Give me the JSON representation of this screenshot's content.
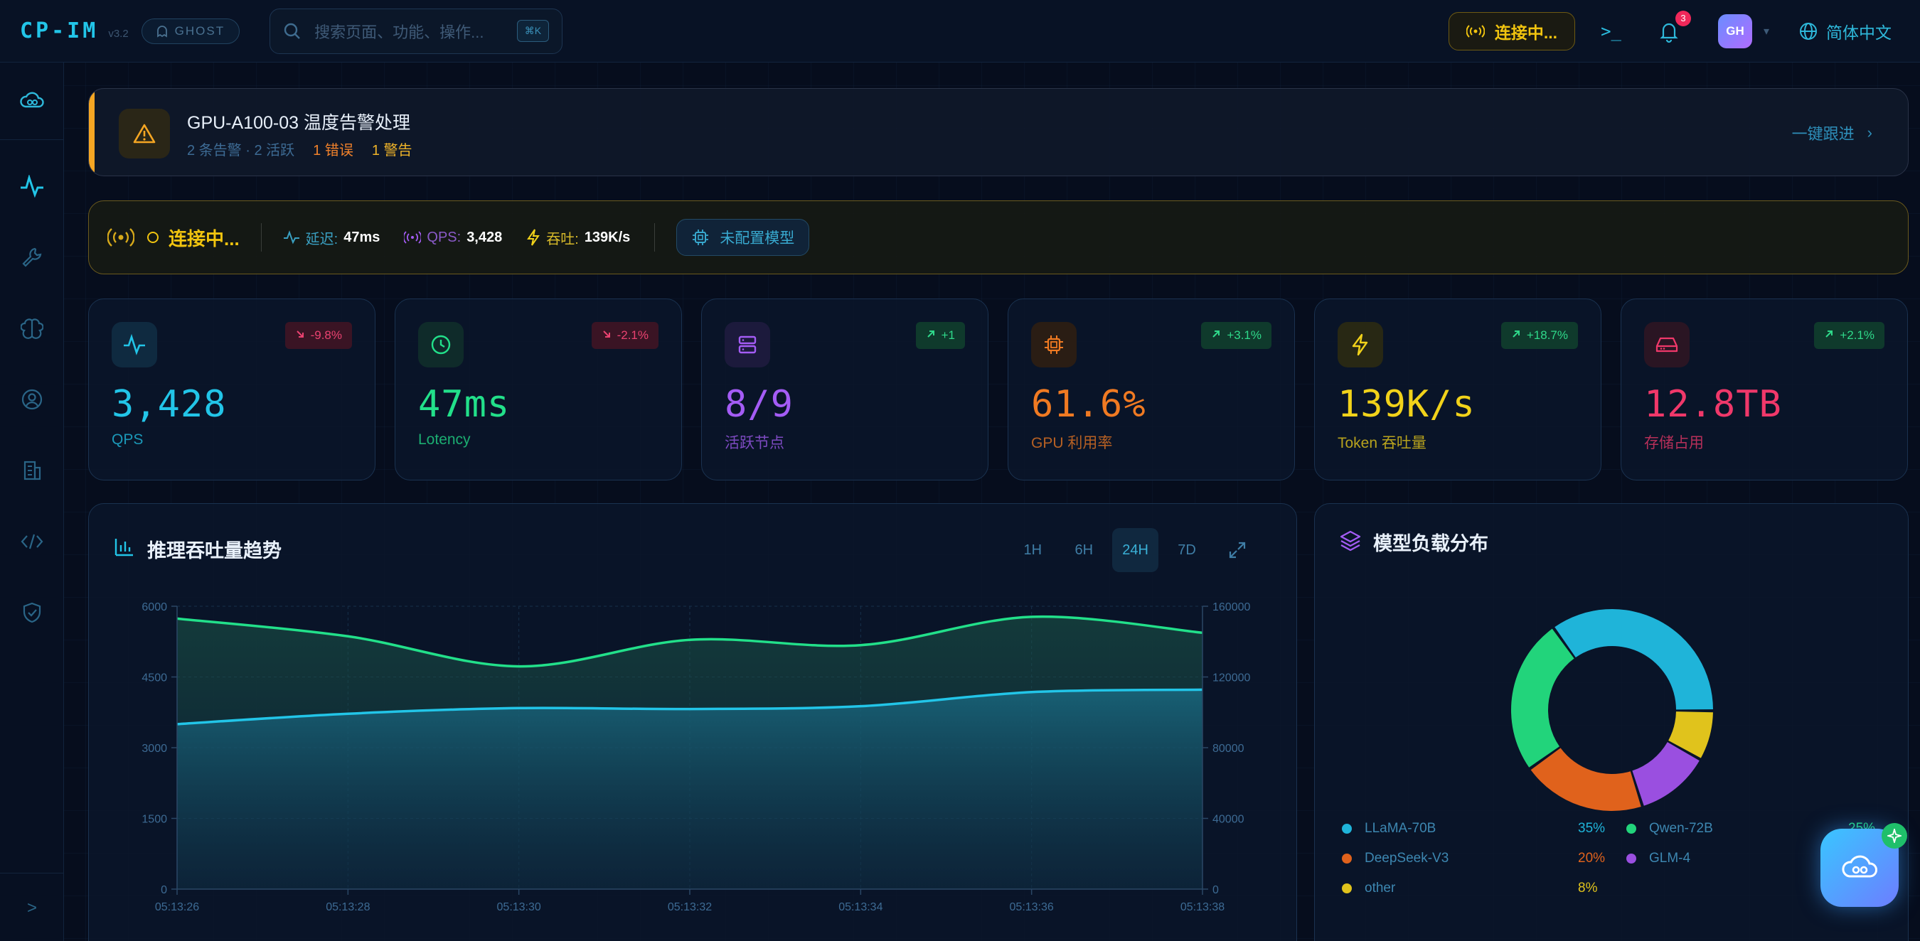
{
  "header": {
    "logo": "CP-IM",
    "version": "v3.2",
    "mode": "GHOST",
    "search_placeholder": "搜索页面、功能、操作...",
    "search_shortcut": "⌘K",
    "connection": "连接中...",
    "terminal": ">_",
    "notifications": "3",
    "avatar": "GH",
    "language": "简体中文"
  },
  "sidebar": {
    "items": [
      "cloud-icon",
      "activity-icon",
      "wrench-icon",
      "brain-icon",
      "user-icon",
      "building-icon",
      "code-icon",
      "shield-icon"
    ],
    "expand": ">"
  },
  "alert": {
    "title": "GPU-A100-03 温度告警处理",
    "meta_summary": "2 条告警 · 2 活跃",
    "errors": "1 错误",
    "warnings": "1 警告",
    "action": "一键跟进",
    "accent": "#f5a623"
  },
  "status": {
    "connection": "连接中...",
    "latency_label": "延迟:",
    "latency_value": "47ms",
    "qps_label": "QPS:",
    "qps_value": "3,428",
    "throughput_label": "吞吐:",
    "throughput_value": "139K/s",
    "model_button": "未配置模型"
  },
  "stats": [
    {
      "value": "3,428",
      "label": "QPS",
      "change": "-9.8%",
      "trend": "down",
      "color": "#22c5e8",
      "icon": "activity-icon"
    },
    {
      "value": "47ms",
      "label": "Lotency",
      "change": "-2.1%",
      "trend": "down",
      "color": "#22e08a",
      "icon": "clock-icon"
    },
    {
      "value": "8/9",
      "label": "活跃节点",
      "change": "+1",
      "trend": "up",
      "color": "#a45cf5",
      "icon": "server-icon"
    },
    {
      "value": "61.6%",
      "label": "GPU 利用率",
      "change": "+3.1%",
      "trend": "up",
      "color": "#f07a22",
      "icon": "cpu-icon"
    },
    {
      "value": "139K/s",
      "label": "Token 吞吐量",
      "change": "+18.7%",
      "trend": "up",
      "color": "#f1d21a",
      "icon": "zap-icon"
    },
    {
      "value": "12.8TB",
      "label": "存储占用",
      "change": "+2.1%",
      "trend": "up",
      "color": "#f0386a",
      "icon": "hdd-icon"
    }
  ],
  "chart": {
    "title": "推理吞吐量趋势",
    "ranges": [
      "1H",
      "6H",
      "24H",
      "7D"
    ],
    "active_range": "24H"
  },
  "chart_data": [
    {
      "type": "area",
      "x": [
        "05:13:26",
        "05:13:28",
        "05:13:30",
        "05:13:32",
        "05:13:34",
        "05:13:36",
        "05:13:38"
      ],
      "y_left_ticks": [
        "6000",
        "4500",
        "3000",
        "1500",
        "0"
      ],
      "y_right_ticks": [
        "160000",
        "120000",
        "80000",
        "40000",
        "0"
      ],
      "ylim_left": [
        0,
        6000
      ],
      "ylim_right": [
        0,
        160000
      ],
      "grid": true,
      "series": [
        {
          "axis": "left",
          "color": "#22c5e8",
          "values": [
            3500,
            3720,
            3840,
            3820,
            3880,
            4180,
            4230
          ]
        },
        {
          "axis": "right",
          "color": "#22e08a",
          "values": [
            153000,
            143000,
            126000,
            141000,
            138000,
            154000,
            145000
          ]
        }
      ]
    },
    {
      "type": "pie",
      "title": "模型负载分布",
      "labels": [
        "LLaMA-70B",
        "Qwen-72B",
        "DeepSeek-V3",
        "GLM-4",
        "other"
      ],
      "values": [
        35,
        25,
        20,
        12,
        8
      ],
      "percent_labels": [
        "35%",
        "25%",
        "20%",
        "12%",
        "8%"
      ],
      "colors": [
        "#1fb4d9",
        "#22d47b",
        "#e0621c",
        "#9a4fe0",
        "#e0c31c"
      ]
    }
  ]
}
